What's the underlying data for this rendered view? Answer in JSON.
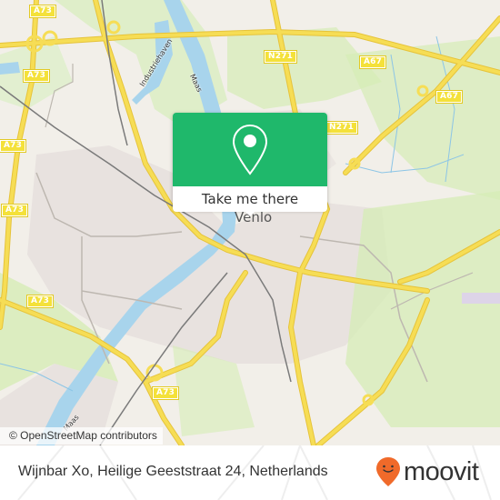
{
  "map": {
    "city_label": "Venlo",
    "road_shields": [
      {
        "id": "a73-1",
        "label": "A73"
      },
      {
        "id": "a73-2",
        "label": "A73"
      },
      {
        "id": "a73-3",
        "label": "A73"
      },
      {
        "id": "a73-4",
        "label": "A73"
      },
      {
        "id": "a73-5",
        "label": "A73"
      },
      {
        "id": "a73-6",
        "label": "A73"
      },
      {
        "id": "a73-7",
        "label": "A73"
      },
      {
        "id": "n271-1",
        "label": "N271"
      },
      {
        "id": "n271-2",
        "label": "N271"
      },
      {
        "id": "a67-1",
        "label": "A67"
      },
      {
        "id": "a67-2",
        "label": "A67"
      }
    ],
    "water_labels": {
      "industriehaven": "Industriehaven",
      "maas_north": "Maas",
      "maas_south": "Maas"
    },
    "colors": {
      "land": "#f2efe9",
      "residential": "#e9e3e0",
      "green": "#d6ecb5",
      "water": "#a8d4ec",
      "motorway": "#f6dd55",
      "rail": "#777777"
    }
  },
  "popup": {
    "icon": "map-pin-icon",
    "button_label": "Take me there",
    "color": "#1fb86b"
  },
  "attribution": "© OpenStreetMap contributors",
  "footer": {
    "address": "Wijnbar Xo, Heilige Geeststraat 24, Netherlands",
    "logo_text": "moovit",
    "logo_icon": "moovit-pin-icon",
    "logo_color": "#f06a2a"
  }
}
